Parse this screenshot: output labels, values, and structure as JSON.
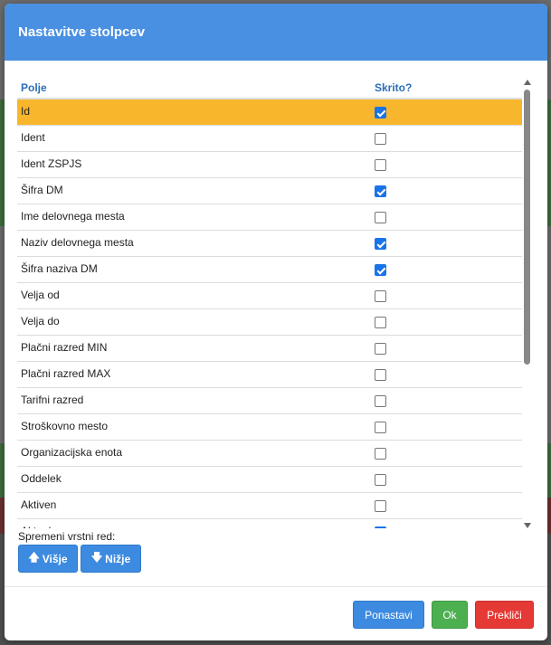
{
  "modal": {
    "title": "Nastavitve stolpcev",
    "columns": {
      "field": "Polje",
      "hidden": "Skrito?"
    },
    "rows": [
      {
        "label": "Id",
        "hidden": true,
        "selected": true
      },
      {
        "label": "Ident",
        "hidden": false
      },
      {
        "label": "Ident ZSPJS",
        "hidden": false
      },
      {
        "label": "Šifra DM",
        "hidden": true
      },
      {
        "label": "Ime delovnega mesta",
        "hidden": false
      },
      {
        "label": "Naziv delovnega mesta",
        "hidden": true
      },
      {
        "label": "Šifra naziva DM",
        "hidden": true
      },
      {
        "label": "Velja od",
        "hidden": false
      },
      {
        "label": "Velja do",
        "hidden": false
      },
      {
        "label": "Plačni razred MIN",
        "hidden": false
      },
      {
        "label": "Plačni razred MAX",
        "hidden": false
      },
      {
        "label": "Tarifni razred",
        "hidden": false
      },
      {
        "label": "Stroškovno mesto",
        "hidden": false
      },
      {
        "label": "Organizacijska enota",
        "hidden": false
      },
      {
        "label": "Oddelek",
        "hidden": false
      },
      {
        "label": "Aktiven",
        "hidden": false
      },
      {
        "label": "Aktualno",
        "hidden": true
      }
    ],
    "reorder_label": "Spremeni vrstni red:",
    "up_label": "Višje",
    "down_label": "Nižje",
    "reset_label": "Ponastavi",
    "ok_label": "Ok",
    "cancel_label": "Prekliči"
  },
  "icons": {
    "up": "arrow-up-icon",
    "down": "arrow-down-icon"
  },
  "colors": {
    "header": "#4a90e2",
    "selected_row": "#f8b62c",
    "primary": "#3d8be0",
    "success": "#4caf50",
    "danger": "#e53935"
  }
}
